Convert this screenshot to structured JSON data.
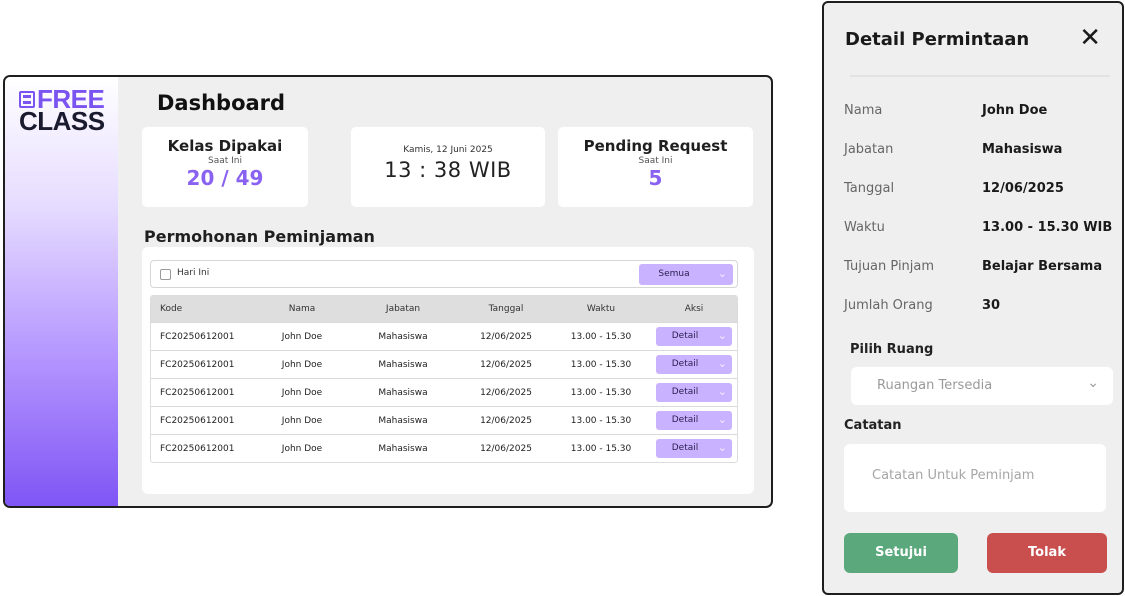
{
  "logo": {
    "top": "FREE",
    "bottom": "CLASS"
  },
  "dashboard": {
    "title": "Dashboard",
    "cards": {
      "kelas": {
        "title": "Kelas Dipakai",
        "sub": "Saat Ini",
        "value": "20 / 49"
      },
      "clock": {
        "date": "Kamis, 12 Juni 2025",
        "time": "13 : 38 WIB"
      },
      "pending": {
        "title": "Pending Request",
        "sub": "Saat Ini",
        "value": "5"
      }
    },
    "section_title": "Permohonan Peminjaman",
    "filter": {
      "today_label": "Hari Ini",
      "select_label": "Semua"
    },
    "table": {
      "headers": [
        "Kode",
        "Nama",
        "Jabatan",
        "Tanggal",
        "Waktu",
        "Aksi"
      ],
      "rows": [
        {
          "kode": "FC20250612001",
          "nama": "John Doe",
          "jabatan": "Mahasiswa",
          "tanggal": "12/06/2025",
          "waktu": "13.00 - 15.30",
          "aksi": "Detail"
        },
        {
          "kode": "FC20250612001",
          "nama": "John Doe",
          "jabatan": "Mahasiswa",
          "tanggal": "12/06/2025",
          "waktu": "13.00 - 15.30",
          "aksi": "Detail"
        },
        {
          "kode": "FC20250612001",
          "nama": "John Doe",
          "jabatan": "Mahasiswa",
          "tanggal": "12/06/2025",
          "waktu": "13.00 - 15.30",
          "aksi": "Detail"
        },
        {
          "kode": "FC20250612001",
          "nama": "John Doe",
          "jabatan": "Mahasiswa",
          "tanggal": "12/06/2025",
          "waktu": "13.00 - 15.30",
          "aksi": "Detail"
        },
        {
          "kode": "FC20250612001",
          "nama": "John Doe",
          "jabatan": "Mahasiswa",
          "tanggal": "12/06/2025",
          "waktu": "13.00 - 15.30",
          "aksi": "Detail"
        }
      ]
    }
  },
  "detail": {
    "title": "Detail Permintaan",
    "fields": [
      {
        "label": "Nama",
        "value": "John Doe"
      },
      {
        "label": "Jabatan",
        "value": "Mahasiswa"
      },
      {
        "label": "Tanggal",
        "value": "12/06/2025"
      },
      {
        "label": "Waktu",
        "value": "13.00 - 15.30 WIB"
      },
      {
        "label": "Tujuan Pinjam",
        "value": "Belajar Bersama"
      },
      {
        "label": "Jumlah Orang",
        "value": "30"
      }
    ],
    "room_label": "Pilih Ruang",
    "room_placeholder": "Ruangan Tersedia",
    "notes_label": "Catatan",
    "notes_placeholder": "Catatan Untuk Peminjam",
    "approve_label": "Setujui",
    "reject_label": "Tolak"
  },
  "colors": {
    "accent_purple": "#8a62f2",
    "button_lavender": "#c9b2ff",
    "approve_green": "#5aa87b",
    "reject_red": "#c94f4f"
  }
}
